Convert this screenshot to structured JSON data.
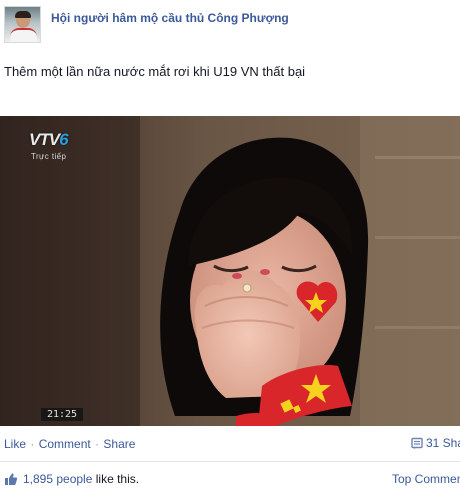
{
  "post": {
    "page_name": "Hội người hâm mộ cầu thủ Công Phượng",
    "message": "Thêm một lần nữa nước mắt rơi khi U19 VN thất bại"
  },
  "photo": {
    "channel_logo_prefix": "VTV",
    "channel_logo_number": "6",
    "live_label": "Trực tiếp",
    "clock": "21:25"
  },
  "actions": {
    "like": "Like",
    "comment": "Comment",
    "share": "Share",
    "separator": "·",
    "shares_count": "31 Sha"
  },
  "footer": {
    "like_count": "1,895 people",
    "like_suffix": "like this.",
    "top_comments": "Top Commen"
  },
  "colors": {
    "link": "#3b5998",
    "text": "#141823",
    "flag_red": "#d8262b",
    "flag_star": "#f6d21e"
  },
  "icons": {
    "share": "share-count-icon",
    "like": "thumbs-up-icon"
  }
}
